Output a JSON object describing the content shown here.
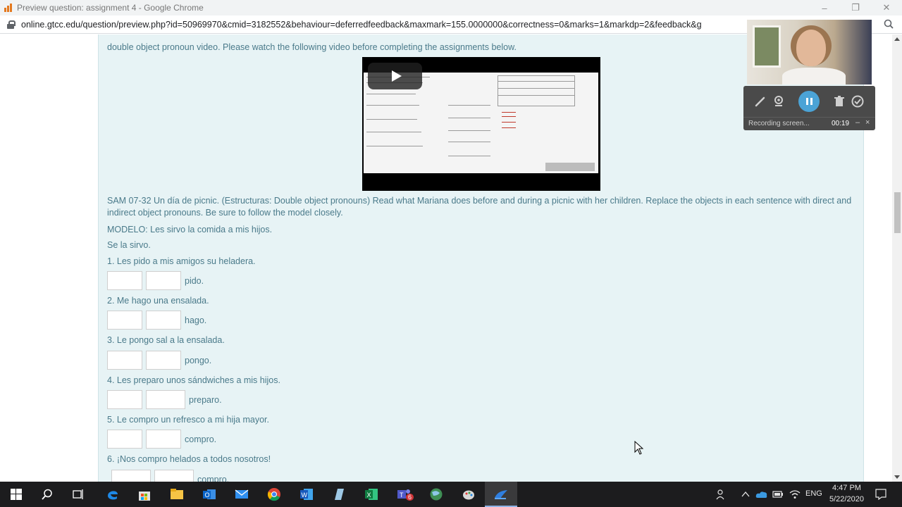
{
  "window": {
    "title": "Preview question: assignment 4 - Google Chrome",
    "url": "online.gtcc.edu/question/preview.php?id=50969970&cmid=3182552&behaviour=deferredfeedback&maxmark=155.0000000&correctness=0&marks=1&markdp=2&feedback&g"
  },
  "page": {
    "intro": "double object pronoun video. Please watch the following video before completing the assignments below.",
    "instructions": "SAM 07-32 Un día de picnic. (Estructuras: Double object pronouns) Read what Mariana does before and during a picnic with her children. Replace the objects in each sentence with direct and indirect object pronouns. Be sure to follow the model closely.",
    "model": "MODELO: Les sirvo la comida a mis hijos.",
    "model_answer": "Se la sirvo.",
    "questions": [
      {
        "prompt": "1. Les pido a mis amigos su heladera.",
        "answer1": "",
        "answer2": "",
        "suffix": "pido."
      },
      {
        "prompt": "2. Me hago una ensalada.",
        "answer1": "",
        "answer2": "",
        "suffix": "hago."
      },
      {
        "prompt": "3. Le pongo sal a la ensalada.",
        "answer1": "",
        "answer2": "",
        "suffix": "pongo."
      },
      {
        "prompt": "4. Les preparo unos sándwiches a mis hijos.",
        "answer1": "",
        "answer2": "",
        "suffix": "preparo."
      },
      {
        "prompt": "5. Le compro un refresco a mi hija mayor.",
        "answer1": "",
        "answer2": "",
        "suffix": "compro."
      },
      {
        "prompt": "6. ¡Nos compro helados a todos nosotros!",
        "answer1": "",
        "answer2": "",
        "suffix": "compro."
      }
    ]
  },
  "recorder": {
    "status": "Recording screen...",
    "time": "00:19",
    "minimize": "–",
    "close": "×"
  },
  "taskbar": {
    "language": "ENG",
    "time": "4:47 PM",
    "date": "5/22/2020",
    "teams_badge": "6"
  },
  "colors": {
    "content_bg": "#e7f3f5",
    "text": "#4a7a8a",
    "recorder_pause": "#4ba3d6",
    "taskbar": "#1c1c1e"
  }
}
